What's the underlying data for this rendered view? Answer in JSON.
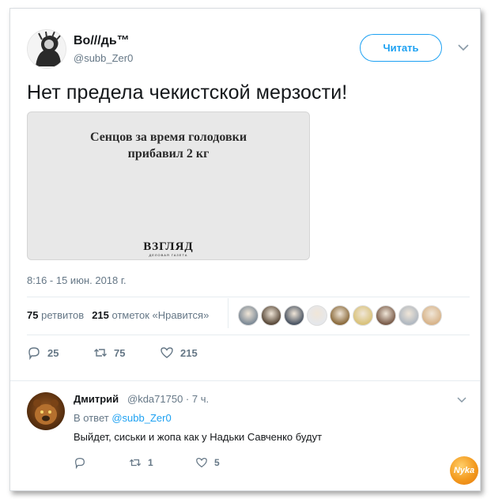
{
  "tweet": {
    "author": {
      "name": "Во///дь™",
      "handle": "@subb_Zer0"
    },
    "follow_label": "Читать",
    "text": "Нет предела чекистской мерзости!",
    "media": {
      "headline_line1": "Сенцов за время голодовки",
      "headline_line2": "прибавил 2 кг",
      "brand": "ВЗГЛЯД",
      "brand_sub": "ДЕЛОВАЯ ГАЗЕТА"
    },
    "timestamp": "8:16 - 15 июн. 2018 г.",
    "stats": {
      "retweets_count": "75",
      "retweets_label": "ретвитов",
      "likes_count": "215",
      "likes_label": "отметок «Нравится»"
    },
    "actions": {
      "replies": "25",
      "retweets": "75",
      "likes": "215"
    },
    "likers": [
      "#7d8a96",
      "#5a4a3a",
      "#4b5563",
      "#e5e7eb",
      "#8b6b3d",
      "#d9c27a",
      "#7a5c4a",
      "#b0b8c1",
      "#d8b48a"
    ]
  },
  "reply": {
    "name": "Дмитрий",
    "meta": "@kda71750 · 7 ч.",
    "in_reply_prefix": "В ответ",
    "in_reply_handle": "@subb_Zer0",
    "text": "Выйдет, сиськи и жопа как у Надьки Савченко будут",
    "actions": {
      "replies": "",
      "retweets": "1",
      "likes": "5"
    }
  },
  "watermark": "Nyka",
  "colors": {
    "accent": "#1da1f2",
    "muted": "#657786"
  }
}
